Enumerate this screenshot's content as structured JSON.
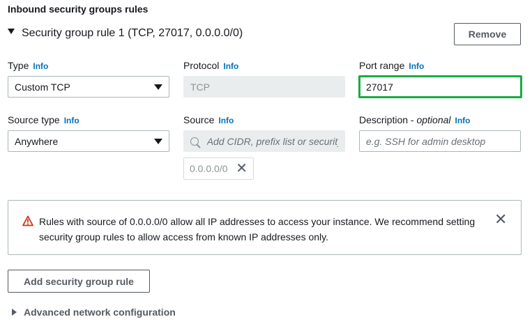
{
  "section_title": "Inbound security groups rules",
  "rule": {
    "title": "Security group rule 1 (TCP, 27017, 0.0.0.0/0)",
    "remove_label": "Remove"
  },
  "info_label": "Info",
  "fields": {
    "type": {
      "label": "Type",
      "value": "Custom TCP"
    },
    "protocol": {
      "label": "Protocol",
      "value": "TCP"
    },
    "port_range": {
      "label": "Port range",
      "value": "27017"
    },
    "source_type": {
      "label": "Source type",
      "value": "Anywhere"
    },
    "source": {
      "label": "Source",
      "placeholder": "Add CIDR, prefix list or security",
      "token": "0.0.0.0/0"
    },
    "description": {
      "label": "Description - ",
      "label_optional": "optional",
      "placeholder": "e.g. SSH for admin desktop"
    }
  },
  "alert": {
    "text": "Rules with source of 0.0.0.0/0 allow all IP addresses to access your instance. We recommend setting security group rules to allow access from known IP addresses only.",
    "icon": "warning-icon",
    "close_icon": "close-icon"
  },
  "add_rule_label": "Add security group rule",
  "advanced_label": "Advanced network configuration",
  "colors": {
    "info_link": "#0073bb",
    "highlight_border": "#1aab40",
    "warning": "#d13212"
  }
}
